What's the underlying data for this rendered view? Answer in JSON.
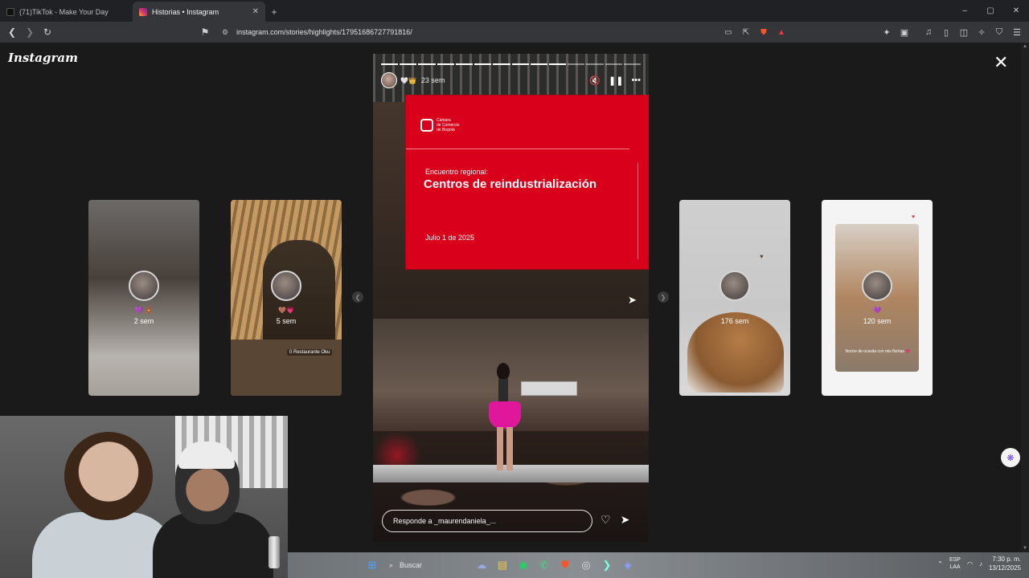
{
  "browser": {
    "tabs": [
      {
        "title": "(71)TikTok - Make Your Day",
        "active": false,
        "favicon_color": "#111111"
      },
      {
        "title": "Historias • Instagram",
        "active": true,
        "favicon_color": "#d6336c"
      }
    ],
    "new_tab": "+",
    "url": "instagram.com/stories/highlights/17951686727791816/",
    "window_controls": [
      "–",
      "▢",
      "✕"
    ]
  },
  "page": {
    "logo": "Instagram",
    "close": "✕"
  },
  "previews": [
    {
      "time": "2 sem",
      "emoji": "💜 🧸"
    },
    {
      "time": "5 sem",
      "emoji": "🤎💗",
      "tag": "0 Restaurante Oku"
    },
    {
      "time": "176 sem",
      "emoji": ""
    },
    {
      "time": "120 sem",
      "emoji": "💜",
      "note": "Noche de ocasita con mis floritas 💗"
    }
  ],
  "story": {
    "time": "23 sem",
    "segments_total": 14,
    "segments_done": 10,
    "screen": {
      "brand": [
        "Cámara",
        "de Comercio",
        "de Bogotá"
      ],
      "subtitle": "Encuentro regional:",
      "title": "Centros de reindustrialización",
      "date": "Julio 1 de 2025"
    },
    "reply_placeholder": "Responde a _maurendaniela_...",
    "icons": [
      "mute-icon",
      "pause-icon",
      "more-icon",
      "heart-icon",
      "send-icon"
    ]
  },
  "taskbar": {
    "search": "Buscar",
    "lang_top": "ESP",
    "lang_bottom": "LAA",
    "time": "7:30 p. m.",
    "date": "13/12/2025"
  }
}
